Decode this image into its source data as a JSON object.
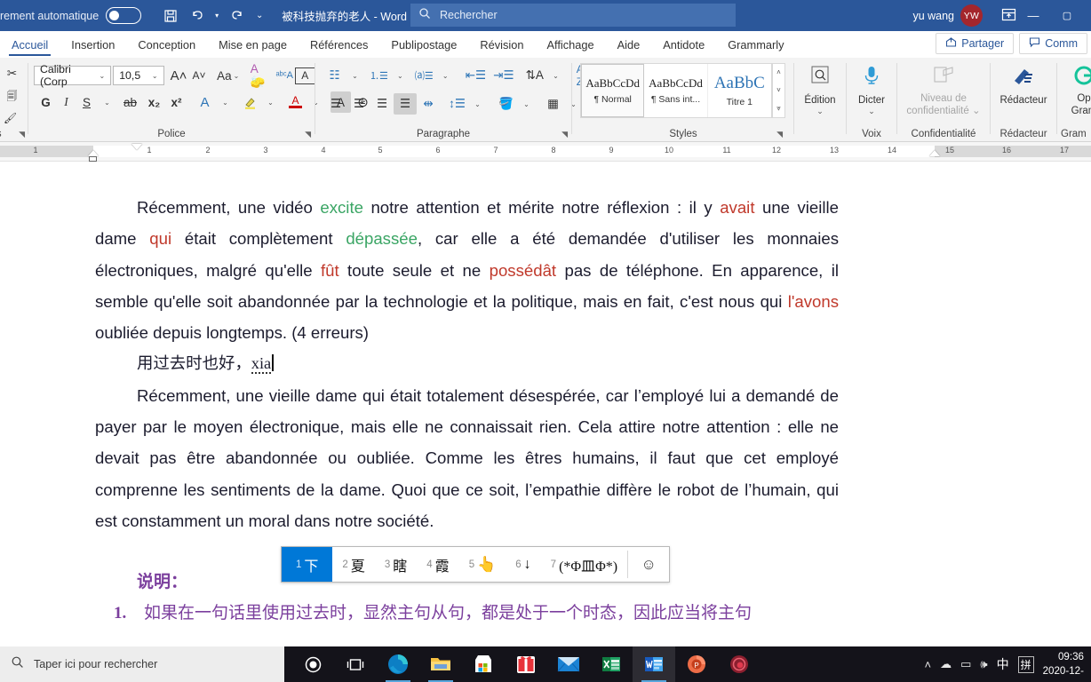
{
  "titlebar": {
    "autosave_label": "rement automatique",
    "autosave_state": "off",
    "save_icon": "save-icon",
    "undo_icon": "undo-icon",
    "redo_icon": "redo-icon",
    "customize_icon": "chevron-down-icon",
    "doc_title": "被科技抛弃的老人  -  Word",
    "search_placeholder": "Rechercher",
    "search_icon": "search-icon",
    "user_name": "yu wang",
    "user_initials": "YW",
    "ribbon_display_icon": "ribbon-display-icon",
    "minimize": "—",
    "maximize": "▢",
    "accent_color": "#2b579a"
  },
  "tabs": [
    {
      "label": "Accueil",
      "active": true
    },
    {
      "label": "Insertion",
      "active": false
    },
    {
      "label": "Conception",
      "active": false
    },
    {
      "label": "Mise en page",
      "active": false
    },
    {
      "label": "Références",
      "active": false
    },
    {
      "label": "Publipostage",
      "active": false
    },
    {
      "label": "Révision",
      "active": false
    },
    {
      "label": "Affichage",
      "active": false
    },
    {
      "label": "Aide",
      "active": false
    },
    {
      "label": "Antidote",
      "active": false
    },
    {
      "label": "Grammarly",
      "active": false
    }
  ],
  "tab_actions": {
    "share_label": "Partager",
    "share_icon": "share-icon",
    "comments_label": "Comm",
    "comments_icon": "comment-icon"
  },
  "ribbon": {
    "groups": [
      {
        "name": "clipboard",
        "label": "rs"
      },
      {
        "name": "font",
        "label": "Police"
      },
      {
        "name": "paragraph",
        "label": "Paragraphe"
      },
      {
        "name": "styles",
        "label": "Styles"
      },
      {
        "name": "editing",
        "label": ""
      },
      {
        "name": "voice",
        "label": "Voix"
      },
      {
        "name": "sensitivity",
        "label": "Confidentialité"
      },
      {
        "name": "editor",
        "label": "Rédacteur"
      },
      {
        "name": "grammarly",
        "label": "Gram"
      }
    ],
    "font": {
      "family": "Calibri (Corp",
      "size": "10,5",
      "grow_icon": "increase-font-size-icon",
      "shrink_icon": "decrease-font-size-icon",
      "change_case_label": "Aa",
      "clear_format_icon": "clear-formatting-icon",
      "phonetic_icon": "phonetic-guide-icon",
      "border_char_icon": "character-border-icon",
      "bold_label": "G",
      "italic_label": "I",
      "underline_label": "S",
      "strike_label": "ab",
      "subscript_label": "x₂",
      "superscript_label": "x²",
      "text_effects_icon": "text-effects-icon",
      "highlight_icon": "highlight-icon",
      "font_color_icon": "font-color-icon",
      "shading_char_icon": "character-shading-icon",
      "enclose_icon": "enclose-character-icon"
    },
    "paragraph": {
      "bullets_icon": "bullet-list-icon",
      "numbering_icon": "numbered-list-icon",
      "multilevel_icon": "multilevel-list-icon",
      "dec_indent_icon": "decrease-indent-icon",
      "inc_indent_icon": "increase-indent-icon",
      "sort_icon": "sort-icon",
      "az_sort_icon": "sort-az-icon",
      "marks_icon": "formatting-marks-icon",
      "align_left_icon": "align-left-icon",
      "align_center_icon": "align-center-icon",
      "align_right_icon": "align-right-icon",
      "justify_icon": "justify-icon",
      "distribute_icon": "distribute-icon",
      "line_spacing_icon": "line-spacing-icon",
      "shading_icon": "shading-icon",
      "borders_icon": "borders-icon"
    },
    "styles": [
      {
        "preview": "AaBbCcDd",
        "name": "¶ Normal",
        "active": true
      },
      {
        "preview": "AaBbCcDd",
        "name": "¶ Sans int...",
        "active": false
      },
      {
        "preview": "AaBbC",
        "name": "Titre 1",
        "active": false
      }
    ],
    "editing": {
      "label": "Édition",
      "icon": "find-icon"
    },
    "voice": {
      "label": "Dicter",
      "icon": "microphone-icon"
    },
    "sensitivity": {
      "label": "Niveau de\nconfidentialité",
      "icon": "sensitivity-icon"
    },
    "editor": {
      "label": "Rédacteur",
      "icon": "editor-pen-icon"
    },
    "grammarly": {
      "label": "Op\nGram",
      "icon": "grammarly-icon"
    }
  },
  "ruler": {
    "left_ticks": [
      "1"
    ],
    "ticks": [
      "1",
      "2",
      "3",
      "4",
      "5",
      "6",
      "7",
      "8",
      "9",
      "10",
      "11",
      "12",
      "13",
      "14",
      "15",
      "16",
      "17"
    ]
  },
  "document": {
    "paragraph1": {
      "segments": [
        {
          "text": "Récemment, une vidéo ",
          "style": "plain"
        },
        {
          "text": "excite",
          "style": "green"
        },
        {
          "text": " notre attention et mérite notre réflexion : il y ",
          "style": "plain"
        },
        {
          "text": "avait",
          "style": "red"
        },
        {
          "text": " une vieille dame ",
          "style": "plain"
        },
        {
          "text": "qui",
          "style": "red"
        },
        {
          "text": " était complètement ",
          "style": "plain"
        },
        {
          "text": "dépassée",
          "style": "green"
        },
        {
          "text": ", car elle a été demandée d'utiliser les monnaies électroniques, malgré qu'elle ",
          "style": "plain"
        },
        {
          "text": "fût",
          "style": "red"
        },
        {
          "text": " toute seule et ne ",
          "style": "plain"
        },
        {
          "text": "possédât",
          "style": "red"
        },
        {
          "text": " pas de téléphone. En apparence, il semble qu'elle soit abandonnée par la technologie et la politique, mais en fait, c'est nous qui ",
          "style": "plain"
        },
        {
          "text": "l'avons",
          "style": "red"
        },
        {
          "text": " oubliée depuis longtemps. (4 erreurs)",
          "style": "plain"
        }
      ]
    },
    "chinese_input_line": {
      "text": "用过去时也好，",
      "composing": "xia"
    },
    "paragraph2": "Récemment, une vieille dame qui était totalement désespérée, car l’employé lui a demandé de payer par le moyen électronique, mais elle ne connaissait rien. Cela attire notre attention : elle ne devait pas être abandonnée ou oubliée. Comme les êtres humains, il faut que cet employé comprenne les sentiments de la dame. Quoi que ce soit, l’empathie diffère le robot de l’humain, qui est constamment un moral dans notre société.",
    "heading_cn": "说明：",
    "list_item_1_num": "1.",
    "list_item_1_text": "如果在一句话里使用过去时，显然主句从句，都是处于一个时态，因此应当将主句"
  },
  "ime": {
    "candidates": [
      {
        "index": "1",
        "text": "下",
        "selected": true
      },
      {
        "index": "2",
        "text": "夏",
        "selected": false
      },
      {
        "index": "3",
        "text": "瞎",
        "selected": false
      },
      {
        "index": "4",
        "text": "霞",
        "selected": false
      },
      {
        "index": "5",
        "text": "👆",
        "selected": false
      },
      {
        "index": "6",
        "text": "↓",
        "selected": false
      },
      {
        "index": "7",
        "text": "(*Φ皿Φ*)",
        "selected": false
      }
    ],
    "smiley_icon": "smiley-icon",
    "selected_color": "#0078d7"
  },
  "taskbar": {
    "search_placeholder": "Taper ici pour rechercher",
    "search_icon": "search-icon",
    "cortana_icon": "cortana-icon",
    "taskview_icon": "task-view-icon",
    "apps": [
      {
        "name": "edge-icon",
        "open": true
      },
      {
        "name": "file-explorer-icon",
        "open": true
      },
      {
        "name": "microsoft-store-icon",
        "open": false
      },
      {
        "name": "gift-icon",
        "open": false
      },
      {
        "name": "mail-icon",
        "open": false
      },
      {
        "name": "excel-icon",
        "open": false
      },
      {
        "name": "word-icon",
        "open": true,
        "active": true
      },
      {
        "name": "powerpoint-icon",
        "open": false
      },
      {
        "name": "record-icon",
        "open": false
      }
    ],
    "tray": {
      "chevron_icon": "show-hidden-icons-icon",
      "cloud_icon": "onedrive-icon",
      "battery_icon": "battery-icon",
      "volume_icon": "volume-icon",
      "ime_mode": "中",
      "ime_method": "拼",
      "time": "09:36",
      "date": "2020-12-"
    }
  }
}
